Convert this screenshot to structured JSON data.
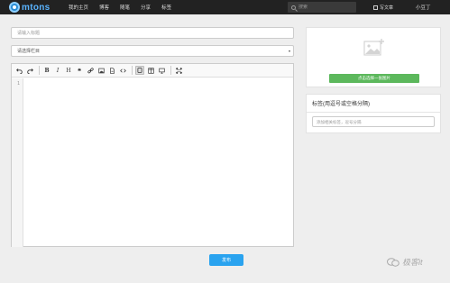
{
  "brand": {
    "name": "mtons",
    "accent": "#2a8dd4"
  },
  "nav": {
    "items": [
      {
        "label": "我的主页"
      },
      {
        "label": "博客"
      },
      {
        "label": "随笔"
      },
      {
        "label": "分享"
      },
      {
        "label": "标签"
      }
    ]
  },
  "search": {
    "placeholder": "搜索"
  },
  "header": {
    "write_label": "写文章",
    "user_name": "小豆丁"
  },
  "post": {
    "title_placeholder": "请输入标题",
    "category_value": "请选择栏目",
    "editor_line": "1"
  },
  "toolbar": {
    "icons": [
      "undo-icon",
      "redo-icon",
      "bold-icon",
      "italic-icon",
      "heading-icon",
      "quote-icon",
      "link-icon",
      "image-icon",
      "file-icon",
      "code-icon",
      "edit-mode-icon",
      "split-mode-icon",
      "preview-mode-icon",
      "fullscreen-icon"
    ],
    "bold": "B",
    "italic": "I",
    "heading": "H",
    "quote": "❝"
  },
  "cover": {
    "button_label": "点击选择一张图片"
  },
  "tags": {
    "title": "标签(用逗号或空格分隔)",
    "placeholder": "添加相关标签，逗号分隔"
  },
  "publish": {
    "label": "发布"
  },
  "watermark": {
    "text": "极客it"
  }
}
